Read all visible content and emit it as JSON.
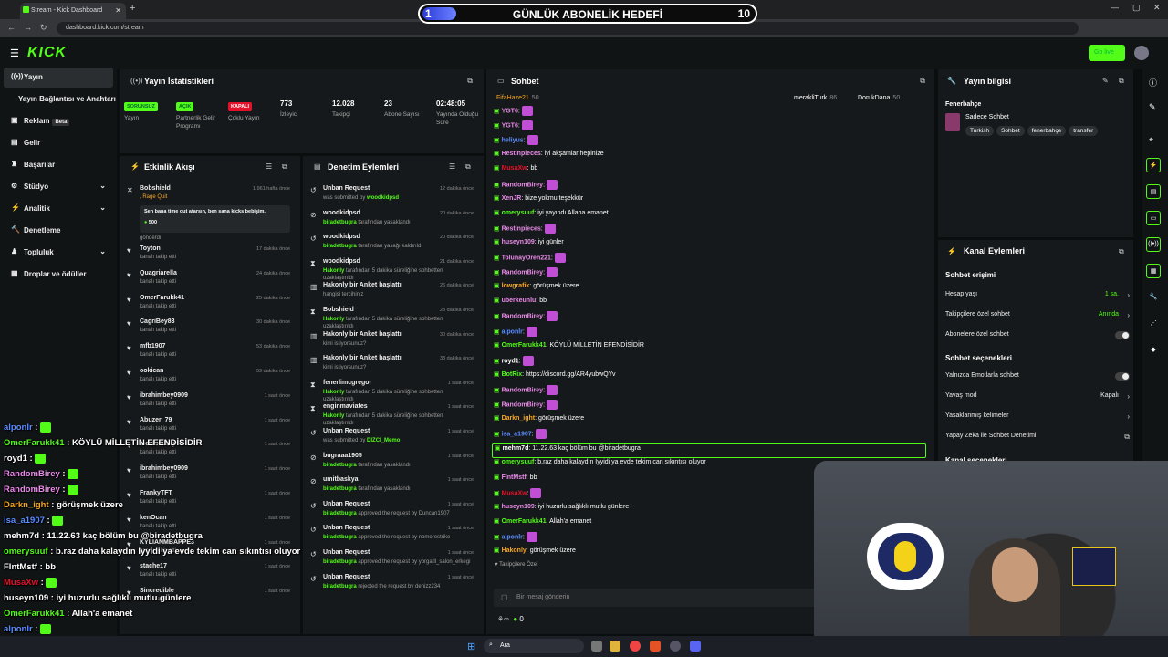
{
  "browser": {
    "tab_title": "Stream - Kick Dashboard",
    "url": "dashboard.kick.com/stream"
  },
  "goal": {
    "left": "1",
    "title": "GÜNLÜK ABONELİK HEDEFİ",
    "right": "10",
    "progress": 0.1
  },
  "header": {
    "logo": "KICK",
    "golive": "Go live"
  },
  "sidebar": {
    "items": [
      {
        "label": "Yayın",
        "icon": "((•))",
        "active": true
      },
      {
        "label": "Yayın Bağlantısı ve Anahtarı",
        "icon": ""
      },
      {
        "label": "Reklam",
        "icon": "▣",
        "beta": "Beta"
      },
      {
        "label": "Gelir",
        "icon": "▤"
      },
      {
        "label": "Başarılar",
        "icon": "♜"
      },
      {
        "label": "Stüdyo",
        "icon": "⚙",
        "chev": true
      },
      {
        "label": "Analitik",
        "icon": "⚡",
        "chev": true
      },
      {
        "label": "Denetleme",
        "icon": "🔨"
      },
      {
        "label": "Topluluk",
        "icon": "♟",
        "chev": true
      },
      {
        "label": "Droplar ve ödüller",
        "icon": "▦"
      }
    ]
  },
  "stats": {
    "title": "Yayın İstatistikleri",
    "items": [
      {
        "badge": "SORUNSUZ",
        "label": "Yayın",
        "color": "#53fc18"
      },
      {
        "badge": "AÇIK",
        "label": "Partnerlik Gelir Programı",
        "color": "#53fc18"
      },
      {
        "badge": "KAPALI",
        "label": "Çoklu Yayın",
        "color": "#e5112a"
      },
      {
        "value": "773",
        "label": "İzleyici"
      },
      {
        "value": "12.028",
        "label": "Takipçi"
      },
      {
        "value": "23",
        "label": "Abone Sayısı"
      },
      {
        "value": "02:48:05",
        "label": "Yayında Olduğu Süre"
      }
    ]
  },
  "activity": {
    "title": "Etkinlik Akışı",
    "items": [
      {
        "name": "Bobshield",
        "desc": ", Rage Quit",
        "time": "1.961 hafta önce",
        "extra": "Sen bana time out atarsın, ben sana kicks bebişim.",
        "kicks": "500",
        "sent": "gönderdi"
      },
      {
        "name": "Toyton",
        "desc": "kanalı takip etti",
        "time": "17 dakika önce"
      },
      {
        "name": "Quagriarella",
        "desc": "kanalı takip etti",
        "time": "24 dakika önce"
      },
      {
        "name": "OmerFarukk41",
        "desc": "kanalı takip etti",
        "time": "25 dakika önce"
      },
      {
        "name": "CagriBey83",
        "desc": "kanalı takip etti",
        "time": "30 dakika önce"
      },
      {
        "name": "mfb1907",
        "desc": "kanalı takip etti",
        "time": "53 dakika önce"
      },
      {
        "name": "ookican",
        "desc": "kanalı takip etti",
        "time": "59 dakika önce"
      },
      {
        "name": "ibrahimbey0909",
        "desc": "kanalı takip etti",
        "time": "1 saat önce"
      },
      {
        "name": "Abuzer_79",
        "desc": "kanalı takip etti",
        "time": "1 saat önce"
      },
      {
        "name": "mevludilakjr",
        "desc": "kanalı takip etti",
        "time": "1 saat önce"
      },
      {
        "name": "ibrahimbey0909",
        "desc": "kanalı takip etti",
        "time": "1 saat önce"
      },
      {
        "name": "FrankyTFT",
        "desc": "kanalı takip etti",
        "time": "1 saat önce"
      },
      {
        "name": "kenOcan",
        "desc": "kanalı takip etti",
        "time": "1 saat önce"
      },
      {
        "name": "KYLIANMBAPPE3",
        "desc": "kanalı takip etti",
        "time": "1 saat önce"
      },
      {
        "name": "stache17",
        "desc": "kanalı takip etti",
        "time": "1 saat önce"
      },
      {
        "name": "Sincredible",
        "desc": "kanalı takip etti",
        "time": "1 saat önce"
      }
    ]
  },
  "moderation": {
    "title": "Denetim Eylemleri",
    "items": [
      {
        "name": "Unban Request",
        "desc": "was submitted by ",
        "user": "woodkidpsd",
        "time": "12 dakika önce",
        "icon": "↺"
      },
      {
        "name": "woodkidpsd",
        "user": "biradetbugra",
        "desc": " tarafından yasaklandı",
        "time": "20 dakika önce",
        "icon": "⊘"
      },
      {
        "name": "woodkidpsd",
        "user": "biradetbugra",
        "desc": " tarafından yasağı kaldırıldı",
        "time": "20 dakika önce",
        "icon": "↺"
      },
      {
        "name": "woodkidpsd",
        "user": "Hakonly",
        "desc": " tarafından 5 dakika süreliğine sohbetten uzaklaştırıldı",
        "time": "21 dakika önce",
        "icon": "⧗"
      },
      {
        "name": "Hakonly bir Anket başlattı",
        "desc": "hangisi tercihiniz",
        "time": "26 dakika önce",
        "icon": "▥"
      },
      {
        "name": "Bobshield",
        "user": "Hakonly",
        "desc": " tarafından 5 dakika süreliğine sohbetten uzaklaştırıldı",
        "time": "28 dakika önce",
        "icon": "⧗"
      },
      {
        "name": "Hakonly bir Anket başlattı",
        "desc": "kimi istiyorsunuz?",
        "time": "30 dakika önce",
        "icon": "▥"
      },
      {
        "name": "Hakonly bir Anket başlattı",
        "desc": "kimi istiyorsunuz?",
        "time": "33 dakika önce",
        "icon": "▥"
      },
      {
        "name": "fenerlimcgregor",
        "user": "Hakonly",
        "desc": " tarafından 5 dakika süreliğine sohbetten uzaklaştırıldı",
        "time": "1 saat önce",
        "icon": "⧗"
      },
      {
        "name": "enginmaviates",
        "user": "Hakonly",
        "desc": " tarafından 5 dakika süreliğine sohbetten uzaklaştırıldı",
        "time": "1 saat önce",
        "icon": "⧗"
      },
      {
        "name": "Unban Request",
        "desc": "was submitted by ",
        "user": "DIZCI_Memo",
        "time": "1 saat önce",
        "icon": "↺"
      },
      {
        "name": "bugraaa1905",
        "user": "biradetbugra",
        "desc": " tarafından yasaklandı",
        "time": "1 saat önce",
        "icon": "⊘"
      },
      {
        "name": "umitbaskya",
        "user": "biradetbugra",
        "desc": " tarafından yasaklandı",
        "time": "1 saat önce",
        "icon": "⊘"
      },
      {
        "name": "Unban Request",
        "user": "biradetbugra",
        "desc": " approved the request by Duncan1907",
        "time": "1 saat önce",
        "icon": "↺"
      },
      {
        "name": "Unban Request",
        "user": "biradetbugra",
        "desc": " approved the request by nomorestrike",
        "time": "1 saat önce",
        "icon": "↺"
      },
      {
        "name": "Unban Request",
        "user": "biradetbugra",
        "desc": " approved the request by yorgatll_salon_erkegi",
        "time": "1 saat önce",
        "icon": "↺"
      },
      {
        "name": "Unban Request",
        "user": "biradetbugra",
        "desc": " rejected the request by denizz234",
        "time": "1 saat önce",
        "icon": "↺"
      }
    ]
  },
  "chat": {
    "title": "Sohbet",
    "top": [
      {
        "name": "FifaHaze21",
        "n": "50"
      },
      {
        "name": "merakliTurk",
        "n": "86"
      },
      {
        "name": "DorukDana",
        "n": "50"
      }
    ],
    "lines": [
      {
        "u": "YGT6",
        "c": "#e98ae8",
        "m": ""
      },
      {
        "u": "YGT6",
        "c": "#e98ae8",
        "m": ""
      },
      {
        "u": "heliyus",
        "c": "#5b8cff",
        "m": ""
      },
      {
        "u": "Restinpieces",
        "c": "#e98ae8",
        "m": "iyi akşamlar hepinize"
      },
      {
        "u": "MusaXw",
        "c": "#e5112a",
        "m": "bb"
      },
      {
        "u": "RandomBirey",
        "c": "#e98ae8",
        "m": ""
      },
      {
        "u": "XenJR",
        "c": "#e98ae8",
        "m": "bize yokmu teşekkür"
      },
      {
        "u": "omerysuuf",
        "c": "#53fc18",
        "m": "iyi yayındı Allaha emanet"
      },
      {
        "u": "Restinpieces",
        "c": "#e98ae8",
        "m": ""
      },
      {
        "u": "huseyn109",
        "c": "#e98ae8",
        "m": "iyi günler"
      },
      {
        "u": "TolunayOren221",
        "c": "#e98ae8",
        "m": ""
      },
      {
        "u": "RandomBirey",
        "c": "#e98ae8",
        "m": ""
      },
      {
        "u": "lowgrafik",
        "c": "#f5a623",
        "m": "görüşmek üzere"
      },
      {
        "u": "uberkeunlu",
        "c": "#e98ae8",
        "m": "bb"
      },
      {
        "u": "RandomBirey",
        "c": "#e98ae8",
        "m": ""
      },
      {
        "u": "alponlr",
        "c": "#5b8cff",
        "m": ""
      },
      {
        "u": "OmerFarukk41",
        "c": "#53fc18",
        "m": "KÖYLÜ MİLLETİN EFENDİSİDİR"
      },
      {
        "u": "royd1",
        "c": "#fff",
        "m": ""
      },
      {
        "u": "BotRix",
        "c": "#53fc18",
        "m": "https://discord.gg/AR4yubwQYv"
      },
      {
        "u": "RandomBirey",
        "c": "#e98ae8",
        "m": ""
      },
      {
        "u": "RandomBirey",
        "c": "#e98ae8",
        "m": ""
      },
      {
        "u": "Darkn_ight",
        "c": "#f5a623",
        "m": "görüşmek üzere"
      },
      {
        "u": "isa_a1907",
        "c": "#5b8cff",
        "m": ""
      },
      {
        "u": "mehm7d",
        "c": "#fff",
        "m": "11.22.63 kaç bölüm bu @biradetbugra",
        "hl": true
      },
      {
        "u": "omerysuuf",
        "c": "#53fc18",
        "m": "b.raz daha kalaydın İyyidi ya evde tekim can sıkıntısı oluyor"
      },
      {
        "u": "FlntMstf",
        "c": "#e98ae8",
        "m": "bb"
      },
      {
        "u": "MusaXw",
        "c": "#e5112a",
        "m": ""
      },
      {
        "u": "huseyn109",
        "c": "#e98ae8",
        "m": "iyi huzurlu sağlıklı mutlu günlere"
      },
      {
        "u": "OmerFarukk41",
        "c": "#53fc18",
        "m": "Allah'a emanet"
      },
      {
        "u": "alponlr",
        "c": "#5b8cff",
        "m": ""
      },
      {
        "u": "Hakonly",
        "c": "#f5a623",
        "m": "görüşmek üzere"
      }
    ],
    "followers_only": "Takipçilere Özel",
    "placeholder": "Bir mesaj gönderin",
    "kicks": "0"
  },
  "overlay": [
    {
      "u": "alponlr",
      "c": "#5b8cff",
      "m": ""
    },
    {
      "u": "OmerFarukk41",
      "c": "#53fc18",
      "m": "KÖYLÜ MİLLETİN EFENDİSİDİR"
    },
    {
      "u": "royd1",
      "c": "#fff",
      "m": ""
    },
    {
      "u": "RandomBirey",
      "c": "#e98ae8",
      "m": ""
    },
    {
      "u": "RandomBirey",
      "c": "#e98ae8",
      "m": ""
    },
    {
      "u": "Darkn_ight",
      "c": "#f5a623",
      "m": "görüşmek üzere"
    },
    {
      "u": "isa_a1907",
      "c": "#5b8cff",
      "m": ""
    },
    {
      "u": "mehm7d",
      "c": "#fff",
      "m": "11.22.63 kaç bölüm bu @biradetbugra"
    },
    {
      "u": "omerysuuf",
      "c": "#53fc18",
      "m": "b.raz daha kalaydın İyyidi ya evde tekim can sıkıntısı oluyor"
    },
    {
      "u": "FlntMstf",
      "c": "#fff",
      "m": "bb"
    },
    {
      "u": "MusaXw",
      "c": "#e5112a",
      "m": ""
    },
    {
      "u": "huseyn109",
      "c": "#fff",
      "m": "iyi huzurlu sağlıklı mutlu günlere"
    },
    {
      "u": "OmerFarukk41",
      "c": "#53fc18",
      "m": "Allah'a emanet"
    },
    {
      "u": "alponlr",
      "c": "#5b8cff",
      "m": ""
    },
    {
      "u": "Hakonly",
      "c": "#fff",
      "m": "görüşmek üzere"
    }
  ],
  "streaminfo": {
    "title": "Yayın bilgisi",
    "game": "Fenerbahçe",
    "stream_title": "Sadece Sohbet",
    "tags": [
      "Turkish",
      "Sohbet",
      "fenerbahçe",
      "transfer"
    ]
  },
  "channel": {
    "title": "Kanal Eylemleri",
    "section1": "Sohbet erişimi",
    "rows1": [
      {
        "label": "Hesap yaşı",
        "val": "1 sa.",
        "green": true
      },
      {
        "label": "Takipçilere özel sohbet",
        "val": "Anında",
        "green": true
      },
      {
        "label": "Abonelere özel sohbet",
        "toggle": true
      }
    ],
    "section2": "Sohbet seçenekleri",
    "rows2": [
      {
        "label": "Yalnızca Emotlarla sohbet",
        "toggle": true
      },
      {
        "label": "Yavaş mod",
        "val": "Kapalı"
      },
      {
        "label": "Yasaklanmış kelimeler"
      },
      {
        "label": "Yapay Zeka ile Sohbet Denetimi",
        "ext": true
      }
    ],
    "section3": "Kanal seçenekleri"
  },
  "taskbar": {
    "search": "Ara"
  }
}
